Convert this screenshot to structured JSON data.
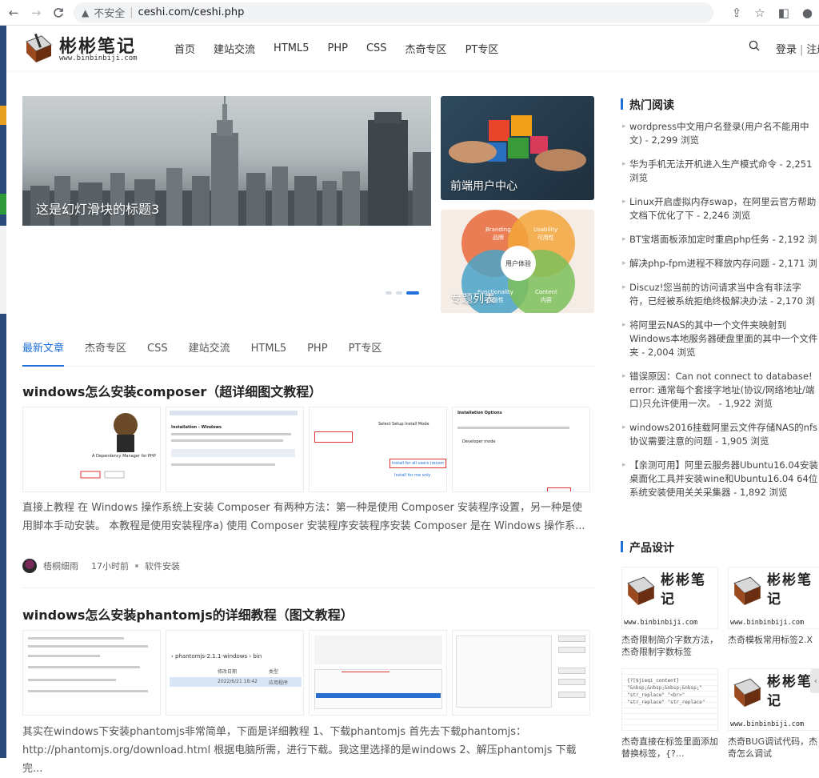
{
  "browser": {
    "back": "←",
    "forward": "→",
    "reload": "C",
    "insecure": "不安全",
    "url": "ceshi.com/ceshi.php"
  },
  "site": {
    "logo_title": "彬彬笔记",
    "logo_sub": "www.binbinbiji.com",
    "nav": [
      "首页",
      "建站交流",
      "HTML5",
      "PHP",
      "CSS",
      "杰奇专区",
      "PT专区"
    ],
    "login": "登录",
    "register": "注册"
  },
  "hero": {
    "slide_caption": "这是幻灯滑块的标题3",
    "tile1_caption": "前端用户中心",
    "tile2_caption": "专题列表",
    "ux_center": "用户体验",
    "ux_labels": [
      "Branding",
      "品牌",
      "Usability",
      "可用性",
      "Functionality",
      "功能性",
      "Content",
      "内容"
    ]
  },
  "tabs": [
    "最新文章",
    "杰奇专区",
    "CSS",
    "建站交流",
    "HTML5",
    "PHP",
    "PT专区"
  ],
  "articles": [
    {
      "title": "windows怎么安装composer（超详细图文教程）",
      "excerpt": "直接上教程 在 Windows 操作系统上安装 Composer 有两种方法：第一种是使用 Composer 安装程序设置，另一种是使用脚本手动安装。 本教程是使用安装程序a) 使用 Composer 安装程序安装程序安装 Composer 是在 Windows 操作系...",
      "author": "梧桐细雨",
      "time": "17小时前",
      "category": "软件安装",
      "thumb_texts": [
        "A Dependency Manager for PHP",
        "Installation - Windows",
        "Select Setup Install Mode",
        "Install for all users (recom",
        "Install for me only",
        "Installation Options",
        "Developer mode"
      ]
    },
    {
      "title": "windows怎么安装phantomjs的详细教程（图文教程）",
      "excerpt": "其实在windows下安装phantomjs非常简单，下面是详细教程 1、下载phantomjs 首先去下载phantomjs：http://phantomjs.org/download.html 根据电脑所需，进行下载。我这里选择的是windows 2、解压phantomjs 下载完...",
      "thumb_texts": [
        "phantomjs-2.1.1-windows",
        "bin",
        "修改日期",
        "类型",
        "2022/6/21 18:42",
        "应用程序"
      ]
    }
  ],
  "sidebar": {
    "hot_title": "热门阅读",
    "hot": [
      "wordpress中文用户名登录(用户名不能用中文) - 2,299 浏览",
      "华为手机无法开机进入生产模式命令 - 2,251 浏览",
      "Linux开启虚拟内存swap，在阿里云官方帮助文档下优化了下 - 2,246 浏览",
      "BT宝塔面板添加定时重启php任务 - 2,192 浏览",
      "解决php-fpm进程不释放内存问题 - 2,171 浏览",
      "Discuz!您当前的访问请求当中含有非法字符，已经被系统拒绝终极解决办法 - 2,170 浏览",
      "将阿里云NAS的其中一个文件夹映射到Windows本地服务器硬盘里面的其中一个文件夹 - 2,004 浏览",
      "错误原因：Can not connect to database! error: 通常每个套接字地址(协议/网络地址/端口)只允许使用一次。 - 1,922 浏览",
      "windows2016挂载阿里云文件存储NAS的nfs协议需要注意的问题 - 1,905 浏览",
      "【亲测可用】阿里云服务器Ubuntu16.04安装桌面化工具并安装wine和Ubuntu16.04 64位系统安装使用关关采集器 - 1,892 浏览"
    ],
    "product_title": "产品设计",
    "products": [
      {
        "caption": "杰奇限制简介字数方法，杰奇限制字数标签"
      },
      {
        "caption": "杰奇模板常用标签2.X"
      },
      {
        "caption": "杰奇直接在标签里面添加替换标签，{?..."
      },
      {
        "caption": "杰奇BUG调试代码，杰奇怎么调试"
      }
    ],
    "product_logo_title": "彬彬笔记",
    "product_logo_sub": "www.binbinbiji.com"
  },
  "colors": {
    "accent": "#1e6fd9"
  }
}
